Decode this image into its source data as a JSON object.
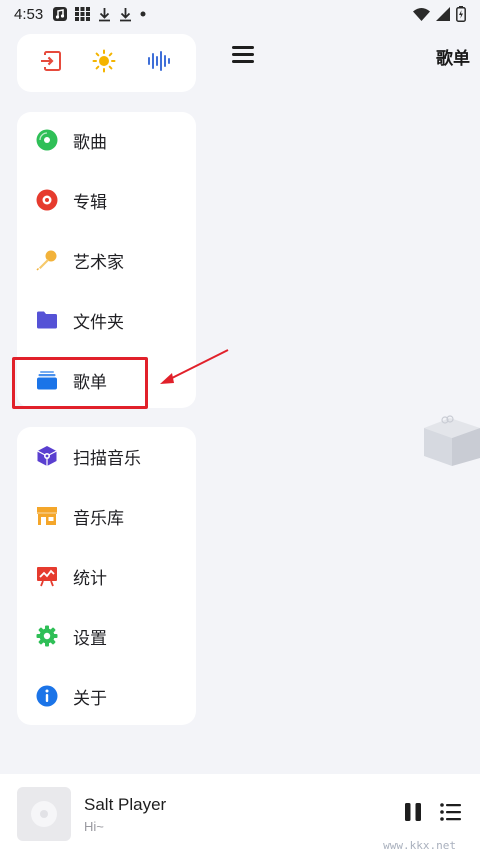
{
  "status_bar": {
    "time": "4:53",
    "left_icons": [
      "music-app-icon",
      "grid-app-icon",
      "download-icon",
      "download-icon",
      "dot-icon"
    ],
    "right_icons": [
      "wifi-icon",
      "signal-icon",
      "battery-icon"
    ]
  },
  "drawer": {
    "quick_actions": [
      {
        "icon": "exit-icon",
        "color": "#e64a3c"
      },
      {
        "icon": "sun-icon",
        "color": "#f4b400"
      },
      {
        "icon": "waveform-icon",
        "color": "#3f6fd8"
      }
    ],
    "library_items": [
      {
        "label": "歌曲",
        "icon": "song-disc-icon",
        "color": "#2fbf57"
      },
      {
        "label": "专辑",
        "icon": "album-disc-icon",
        "color": "#e63b2e"
      },
      {
        "label": "艺术家",
        "icon": "microphone-icon",
        "color": "#f2b23a"
      },
      {
        "label": "文件夹",
        "icon": "folder-icon",
        "color": "#5552d6"
      },
      {
        "label": "歌单",
        "icon": "playlist-stack-icon",
        "color": "#1b74e8"
      }
    ],
    "tool_items": [
      {
        "label": "扫描音乐",
        "icon": "scan-cube-icon",
        "color": "#5a3fd0"
      },
      {
        "label": "音乐库",
        "icon": "store-icon",
        "color": "#f4a62a"
      },
      {
        "label": "统计",
        "icon": "stats-board-icon",
        "color": "#e63b2e"
      },
      {
        "label": "设置",
        "icon": "gear-icon",
        "color": "#2fbf57"
      },
      {
        "label": "关于",
        "icon": "info-icon",
        "color": "#1b74e8"
      }
    ]
  },
  "content": {
    "page_title": "歌单"
  },
  "player": {
    "title": "Salt Player",
    "subtitle": "Hi~"
  },
  "watermark": "www.kkx.net"
}
